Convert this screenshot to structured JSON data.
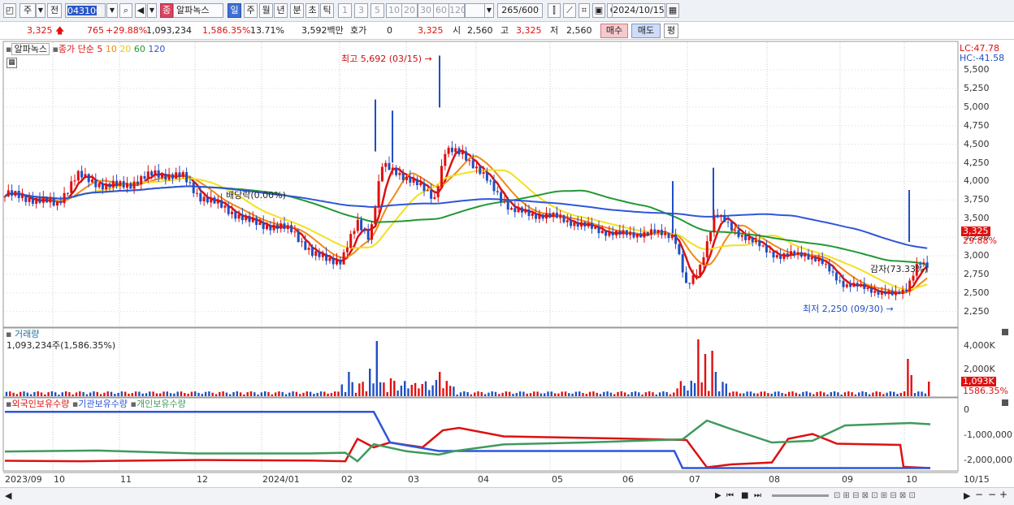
{
  "toolbar": {
    "period_mode": "주",
    "prev_label": "전",
    "stock_code": "043100",
    "stock_name": "알파녹스",
    "badge_label": "종",
    "periods": [
      "일",
      "주",
      "월",
      "년",
      "분",
      "초",
      "틱"
    ],
    "active_period": "일",
    "minute_options": [
      "1",
      "3",
      "5",
      "10",
      "20",
      "30",
      "60",
      "120"
    ],
    "count_value": "265",
    "count_total": "/600",
    "date_value": "2024/10/15"
  },
  "quote": {
    "price": "3,325",
    "change": "765",
    "change_rate": "+29.88%",
    "volume": "1,093,234",
    "volume_rate": "1,586.35%",
    "turnover": "13.71%",
    "amount": "3,592백만",
    "hoga_label": "호가",
    "hoga_value": "0",
    "hoga_price": "3,325",
    "open_label": "시",
    "open_value": "2,560",
    "high_label": "고",
    "high_value": "3,325",
    "low_label": "저",
    "low_value": "2,560",
    "buy_button": "매수",
    "sell_button": "매도",
    "avg_button": "평"
  },
  "price_panel": {
    "legend_name": "알파녹스",
    "legend_ma_title": "종가 단순 5",
    "legend_ma": [
      "10",
      "20",
      "60",
      "120"
    ],
    "lc": "LC:47.78",
    "hc": "HC:-41.58",
    "high_annotation": "최고 5,692 (03/15)",
    "low_annotation": "최저 2,250 (09/30)",
    "dividend_annotation": "배당락(0.00%)",
    "reduction_annotation": "감자(73.33%)",
    "y_axis": [
      "5,500",
      "5,250",
      "5,000",
      "4,750",
      "4,500",
      "4,250",
      "4,000",
      "3,750",
      "3,500",
      "3,250",
      "3,000",
      "2,750",
      "2,500",
      "2,250"
    ],
    "current_price": "3,325",
    "current_rate": "29.88%"
  },
  "volume_panel": {
    "title": "거래량",
    "value": "1,093,234주(1,586.35%)",
    "y_axis": [
      "4,000K",
      "2,000K"
    ],
    "current": "1,093K",
    "current_rate": "1586.35%"
  },
  "holdings_panel": {
    "legend": [
      "외국인보유수량",
      "기관보유수량",
      "개인보유수량"
    ],
    "y_axis": [
      "0",
      "-1,000,000",
      "-2,000,000"
    ]
  },
  "x_axis": [
    "2023/09",
    "10",
    "11",
    "12",
    "2024/01",
    "02",
    "03",
    "04",
    "05",
    "06",
    "07",
    "08",
    "09",
    "10",
    "10/15"
  ],
  "colors": {
    "up": "#e01010",
    "down": "#1f4fc4",
    "ma5": "#dd1111",
    "ma10": "#f08a18",
    "ma20": "#f4e020",
    "ma60": "#229933",
    "ma120": "#2f56d9",
    "foreign": "#dd1111",
    "institution": "#2f56d9",
    "individual": "#3f9a5e"
  }
}
